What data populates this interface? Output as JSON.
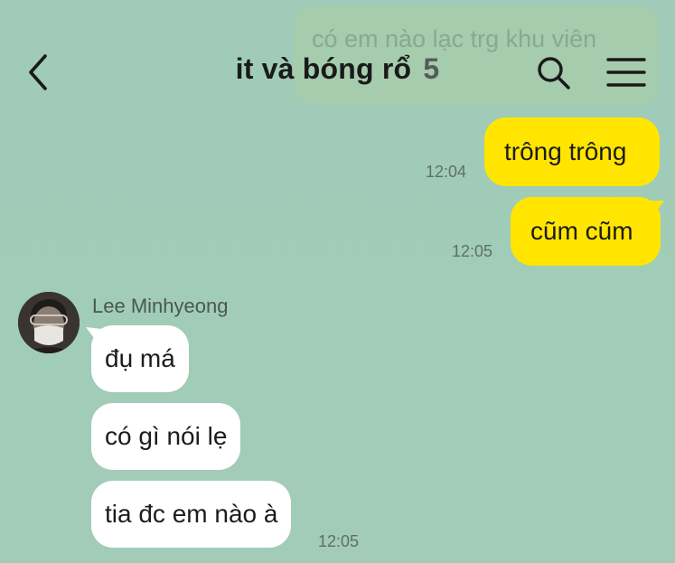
{
  "chat": {
    "title": "it và bóng rổ",
    "member_count": "5",
    "ghost_message": "có em nào lạc trg khu viên"
  },
  "messages_out": [
    {
      "text": "trông trông",
      "time": "12:04"
    },
    {
      "text": "cũm cũm",
      "time": "12:05"
    }
  ],
  "incoming": {
    "sender": "Lee Minhyeong",
    "messages": [
      {
        "text": "đụ má"
      },
      {
        "text": "có gì nói lẹ"
      },
      {
        "text": "tia đc em nào à",
        "time": "12:05"
      }
    ]
  },
  "colors": {
    "background": "#a0cbb9",
    "outgoing_bubble": "#ffe500",
    "incoming_bubble": "#ffffff"
  },
  "icons": {
    "back": "chevron-left-icon",
    "search": "search-icon",
    "menu": "hamburger-menu-icon"
  }
}
